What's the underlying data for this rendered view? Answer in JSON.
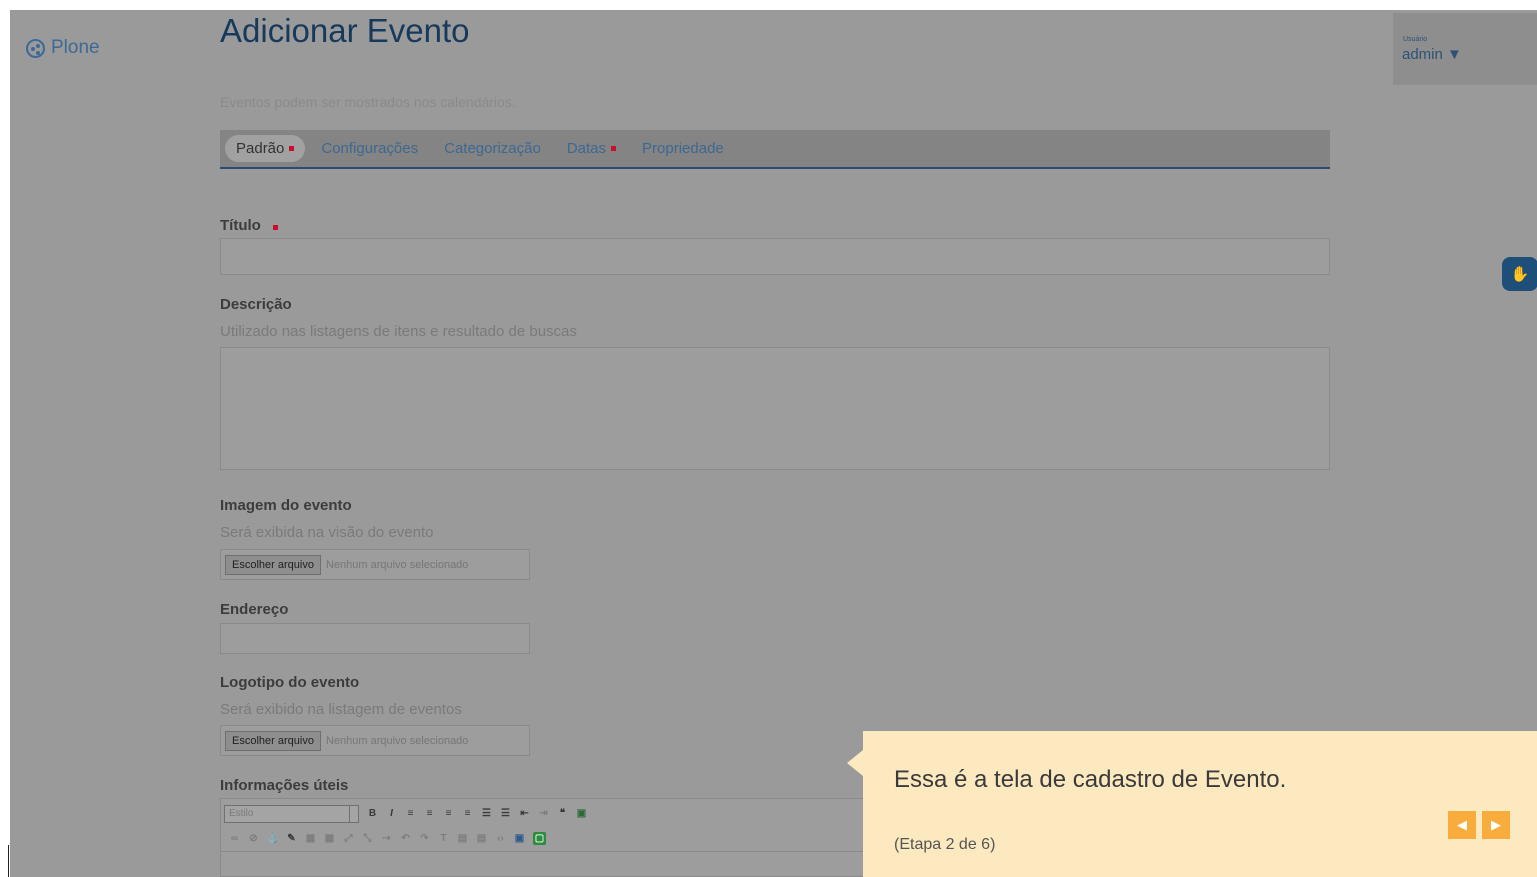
{
  "logo": {
    "text": "Plone",
    "icon": "plone-logo-icon"
  },
  "user": {
    "caption": "Usuário",
    "name": "admin ▼"
  },
  "page": {
    "title": "Adicionar Evento",
    "description": "Eventos podem ser mostrados nos calendários."
  },
  "tabs": [
    {
      "label": "Padrão",
      "required": true,
      "active": true
    },
    {
      "label": "Configurações",
      "required": false
    },
    {
      "label": "Categorização",
      "required": false
    },
    {
      "label": "Datas",
      "required": true
    },
    {
      "label": "Propriedade",
      "required": false
    }
  ],
  "form": {
    "title_label": "Título",
    "title_value": "",
    "description_label": "Descrição",
    "description_help": "Utilizado nas listagens de itens e resultado de buscas",
    "description_value": "",
    "image_label": "Imagem do evento",
    "image_help": "Será exibida na visão do evento",
    "image_button": "Escolher arquivo",
    "image_status": "Nenhum arquivo selecionado",
    "address_label": "Endereço",
    "address_value": "",
    "logo_label": "Logotipo do evento",
    "logo_help": "Será exibido na listagem de eventos",
    "logo_button": "Escolher arquivo",
    "logo_status": "Nenhum arquivo selecionado",
    "info_label": "Informações úteis",
    "editor_style_placeholder": "Estilo"
  },
  "tooltip": {
    "text": "Essa é a tela de cadastro de Evento.",
    "step": "(Etapa 2 de 6)",
    "prev": "◀",
    "next": "▶"
  },
  "colors": {
    "overlay": "#9a9a9a",
    "heading": "#173a5c",
    "link": "#3d6891",
    "required": "#c8102e",
    "tooltip_bg": "#fde9c0",
    "tooltip_nav": "#f8ac3c"
  }
}
